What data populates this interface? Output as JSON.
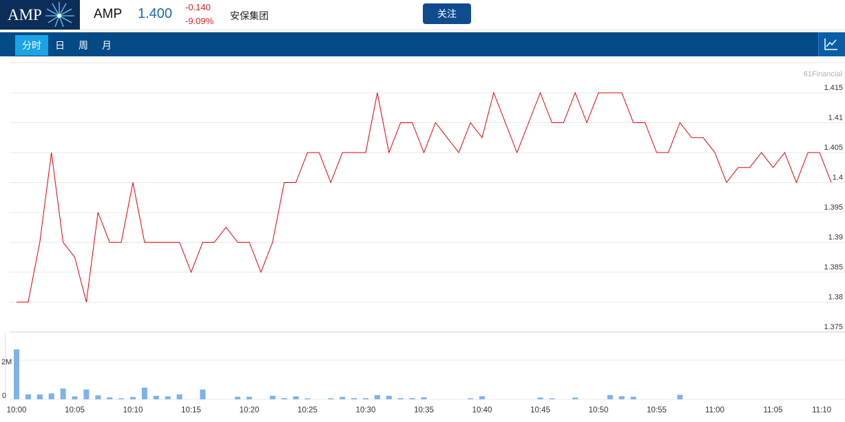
{
  "header": {
    "logo_text": "AMP",
    "ticker": "AMP",
    "price": "1.400",
    "change": "-0.140",
    "change_pct": "-9.09%",
    "name": "安保集团",
    "follow_label": "关注"
  },
  "tabs": [
    {
      "label": "分时",
      "active": true
    },
    {
      "label": "日",
      "active": false
    },
    {
      "label": "周",
      "active": false
    },
    {
      "label": "月",
      "active": false
    }
  ],
  "chart_toggle_icon": "line-chart-icon",
  "colors": {
    "price_line": "#e00000",
    "volume_bar": "#7db2ea",
    "header_bar": "#044a86",
    "tab_active": "#1aa3e6",
    "up_down_text": "#e02020",
    "price_text": "#1c6aa8"
  },
  "chart_data": {
    "type": "line",
    "watermark": "61Financial",
    "ylim": [
      1.375,
      1.415
    ],
    "y_ticks": [
      "1.415",
      "1.41",
      "1.405",
      "1.4",
      "1.395",
      "1.39",
      "1.385",
      "1.38",
      "1.375"
    ],
    "x_ticks": [
      "10:00",
      "10:05",
      "10:10",
      "10:15",
      "10:20",
      "10:25",
      "10:30",
      "10:35",
      "10:40",
      "10:45",
      "10:50",
      "10:55",
      "11:00",
      "11:05",
      "11:10"
    ],
    "series": [
      {
        "name": "",
        "x": [
          0,
          1,
          2,
          3,
          4,
          5,
          6,
          7,
          8,
          9,
          10,
          11,
          12,
          13,
          14,
          15,
          16,
          17,
          18,
          19,
          20,
          21,
          22,
          23,
          24,
          25,
          26,
          27,
          28,
          29,
          30,
          31,
          32,
          33,
          34,
          35,
          36,
          37,
          38,
          39,
          40,
          41,
          42,
          43,
          44,
          45,
          46,
          47,
          48,
          49,
          50,
          51,
          52,
          53,
          54,
          55,
          56,
          57,
          58,
          59,
          60,
          61,
          62,
          63,
          64,
          65,
          66,
          67,
          68,
          69,
          70
        ],
        "values": [
          1.38,
          1.38,
          1.39,
          1.405,
          1.39,
          1.3875,
          1.38,
          1.395,
          1.39,
          1.39,
          1.4,
          1.39,
          1.39,
          1.39,
          1.39,
          1.385,
          1.39,
          1.39,
          1.3925,
          1.39,
          1.39,
          1.385,
          1.39,
          1.4,
          1.4,
          1.405,
          1.405,
          1.4,
          1.405,
          1.405,
          1.405,
          1.415,
          1.405,
          1.41,
          1.41,
          1.405,
          1.41,
          1.4075,
          1.405,
          1.41,
          1.4075,
          1.415,
          1.41,
          1.405,
          1.41,
          1.415,
          1.41,
          1.41,
          1.415,
          1.41,
          1.415,
          1.415,
          1.415,
          1.41,
          1.41,
          1.405,
          1.405,
          1.41,
          1.4075,
          1.4075,
          1.405,
          1.4,
          1.4025,
          1.4025,
          1.405,
          1.4025,
          1.405,
          1.4,
          1.405,
          1.405,
          1.4
        ]
      }
    ],
    "volume": {
      "y_ticks": [
        "2M",
        "0"
      ],
      "ylim": [
        0,
        2600000
      ],
      "x": [
        0,
        1,
        2,
        3,
        4,
        5,
        6,
        7,
        8,
        9,
        10,
        11,
        12,
        13,
        14,
        15,
        16,
        17,
        18,
        19,
        20,
        21,
        22,
        23,
        24,
        25,
        26,
        27,
        28,
        29,
        30,
        31,
        32,
        33,
        34,
        35,
        36,
        37,
        38,
        39,
        40,
        41,
        42,
        43,
        44,
        45,
        46,
        47,
        48,
        49,
        50,
        51,
        52,
        53,
        54,
        55,
        56,
        57,
        58,
        59,
        60,
        61,
        62,
        63,
        64,
        65,
        66,
        67,
        68,
        69,
        70
      ],
      "values": [
        2550000,
        250000,
        250000,
        300000,
        550000,
        150000,
        500000,
        200000,
        100000,
        50000,
        120000,
        600000,
        180000,
        150000,
        250000,
        0,
        500000,
        0,
        0,
        130000,
        130000,
        0,
        180000,
        60000,
        150000,
        50000,
        0,
        50000,
        120000,
        60000,
        60000,
        220000,
        180000,
        60000,
        60000,
        100000,
        0,
        0,
        0,
        40000,
        160000,
        0,
        0,
        0,
        0,
        90000,
        50000,
        0,
        90000,
        0,
        0,
        220000,
        160000,
        130000,
        0,
        0,
        0,
        230000,
        0,
        0,
        0,
        0,
        0,
        0,
        0,
        0,
        0,
        0,
        0,
        0,
        0,
        0,
        0,
        0,
        0,
        0,
        0,
        0,
        0,
        0,
        0,
        0,
        0,
        0,
        0,
        0,
        0,
        0
      ]
    }
  }
}
